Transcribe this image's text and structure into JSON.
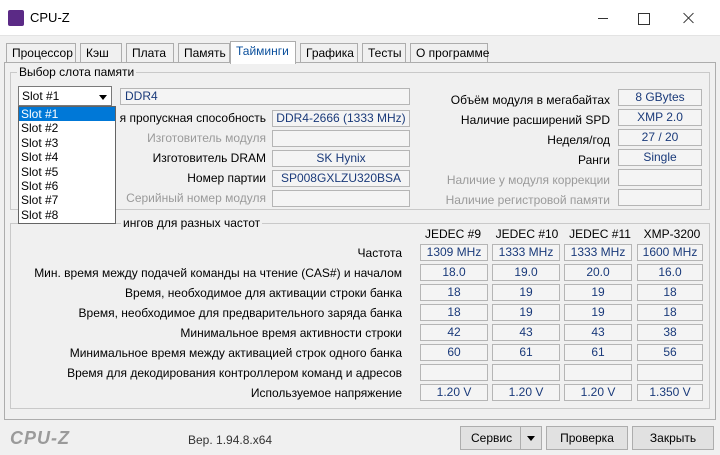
{
  "window": {
    "title": "CPU-Z"
  },
  "tabs": [
    "Процессор",
    "Кэш",
    "Плата",
    "Память",
    "Тайминги",
    "Графика",
    "Тесты",
    "О программе"
  ],
  "slot_group": {
    "title": "Выбор слота памяти",
    "selected_slot": "Slot #1",
    "slot_options": [
      "Slot #1",
      "Slot #2",
      "Slot #3",
      "Slot #4",
      "Slot #5",
      "Slot #6",
      "Slot #7",
      "Slot #8"
    ],
    "type": "DDR4",
    "bandwidth_label": "я пропускная способность",
    "bandwidth": "DDR4-2666 (1333 MHz)",
    "module_manuf_label": "Изготовитель модуля",
    "module_manuf": "",
    "dram_manuf_label": "Изготовитель DRAM",
    "dram_manuf": "SK Hynix",
    "part_label": "Номер партии",
    "part": "SP008GXLZU320BSA",
    "serial_label": "Серийный номер модуля",
    "serial": "",
    "size_label": "Объём модуля в мегабайтах",
    "size": "8 GBytes",
    "spd_ext_label": "Наличие расширений SPD",
    "spd_ext": "XMP 2.0",
    "week_label": "Неделя/год",
    "week": "27 / 20",
    "ranks_label": "Ранги",
    "ranks": "Single",
    "ecc_label": "Наличие у модуля коррекции",
    "ecc": "",
    "registered_label": "Наличие регистровой памяти",
    "registered": ""
  },
  "timings_group": {
    "title": "ингов для разных частот",
    "columns": [
      "JEDEC #9",
      "JEDEC #10",
      "JEDEC #11",
      "XMP-3200"
    ],
    "rows": [
      {
        "label": "Частота",
        "values": [
          "1309 MHz",
          "1333 MHz",
          "1333 MHz",
          "1600 MHz"
        ]
      },
      {
        "label": "Мин. время между подачей команды на чтение (CAS#) и началом",
        "values": [
          "18.0",
          "19.0",
          "20.0",
          "16.0"
        ]
      },
      {
        "label": "Время, необходимое для активации строки банка",
        "values": [
          "18",
          "19",
          "19",
          "18"
        ]
      },
      {
        "label": "Время, необходимое для предварительного заряда банка",
        "values": [
          "18",
          "19",
          "19",
          "18"
        ]
      },
      {
        "label": "Минимальное время активности строки",
        "values": [
          "42",
          "43",
          "43",
          "38"
        ]
      },
      {
        "label": "Минимальное время между активацией строк одного банка",
        "values": [
          "60",
          "61",
          "61",
          "56"
        ]
      },
      {
        "label": "Время для декодирования контроллером команд и адресов",
        "values": [
          "",
          "",
          "",
          ""
        ]
      },
      {
        "label": "Используемое напряжение",
        "values": [
          "1.20 V",
          "1.20 V",
          "1.20 V",
          "1.350 V"
        ]
      }
    ]
  },
  "footer": {
    "logo": "CPU-Z",
    "version": "Вер. 1.94.8.x64",
    "service_button": "Сервис",
    "check_button": "Проверка",
    "close_button": "Закрыть"
  },
  "colors": {
    "selection": "#0078d7",
    "value_text": "#1a3a7a",
    "active_tab_text": "#0a4f9c"
  }
}
